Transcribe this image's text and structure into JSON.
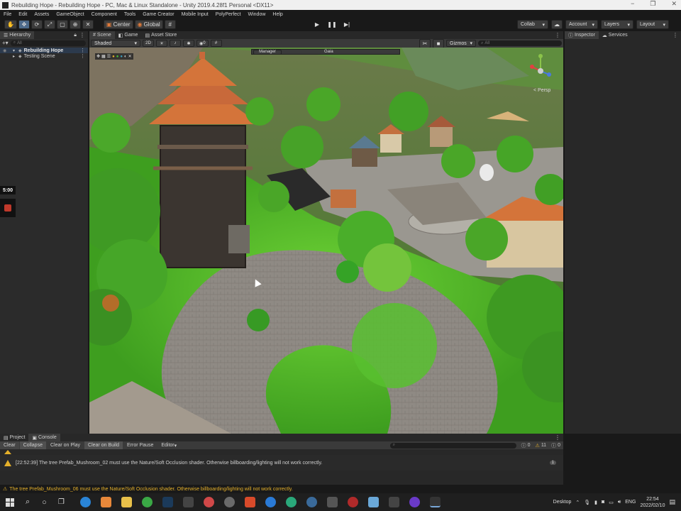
{
  "window": {
    "title": "Rebuilding Hope - Rebuilding Hope - PC, Mac & Linux Standalone - Unity 2019.4.28f1 Personal <DX11>",
    "controls": [
      "−",
      "❐",
      "✕"
    ]
  },
  "menu": [
    "File",
    "Edit",
    "Assets",
    "GameObject",
    "Component",
    "Tools",
    "Game Creator",
    "Mobile Input",
    "PolyPerfect",
    "Window",
    "Help"
  ],
  "toolbar": {
    "pivot": "Center",
    "space": "Global",
    "collab": "Collab",
    "account": "Account",
    "layers": "Layers",
    "layout": "Layout"
  },
  "hierarchy": {
    "tab": "Hierarchy",
    "search_placeholder": "All",
    "items": [
      {
        "label": "Rebuilding Hope",
        "bold": true
      },
      {
        "label": "Testing Scene",
        "bold": false
      }
    ]
  },
  "scene_tabs": [
    "Scene",
    "Game",
    "Asset Store"
  ],
  "scene_toolbar": {
    "shading": "Shaded",
    "mode_2d": "2D",
    "gizmos": "Gizmos",
    "search_placeholder": "All",
    "hidden_count": "0"
  },
  "scene_overlays": {
    "manager": "Manager",
    "gaia": "Gaia",
    "persp": "< Persp"
  },
  "timer": "5:00",
  "inspector_tabs": [
    "Inspector",
    "Services"
  ],
  "console": {
    "tabs": [
      "Project",
      "Console"
    ],
    "buttons": [
      "Clear",
      "Collapse",
      "Clear on Play",
      "Clear on Build",
      "Error Pause",
      "Editor"
    ],
    "counts": {
      "info": "0",
      "warnings": "11",
      "errors": "0"
    },
    "messages": [
      {
        "text": "[22:52:39] The tree Prefab_Mushroom_02 must use the Nature/Soft Occlusion shader. Otherwise billboarding/lighting will not work correctly.",
        "count": "1"
      }
    ]
  },
  "status_message": "The tree Prefab_Mushroom_06 must use the Nature/Soft Occlusion shader. Otherwise billboarding/lighting will not work correctly.",
  "taskbar": {
    "desktop": "Desktop",
    "lang": "ENG",
    "time": "22:54",
    "date": "2022/02/10"
  },
  "colors": {
    "accent": "#4d6a8b",
    "warning": "#e5b02a",
    "grass": "#54c12d",
    "roof": "#d4743a",
    "path": "#8f8a84"
  }
}
